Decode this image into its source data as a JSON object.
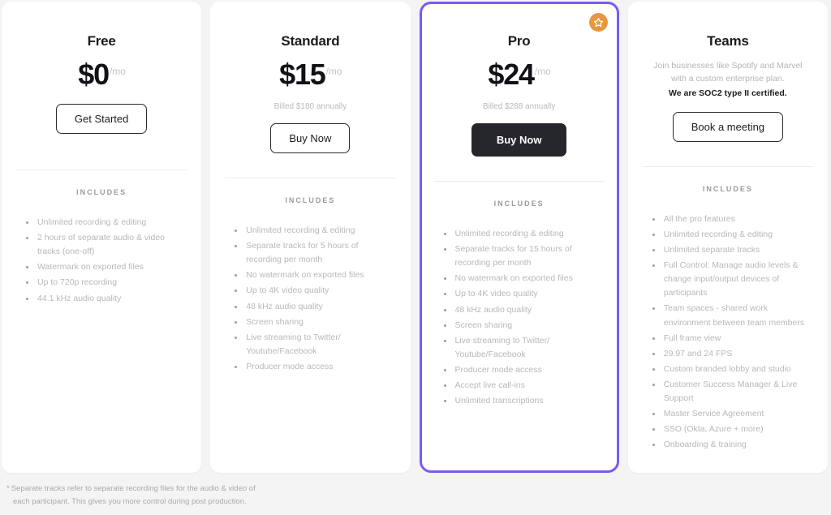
{
  "plans": [
    {
      "id": "free",
      "name": "Free",
      "price": "$0",
      "per": "/mo",
      "billed": "",
      "cta": "Get Started",
      "includes_label": "INCLUDES",
      "features": [
        "Unlimited recording & editing",
        "2 hours of separate audio & video tracks (one-off)",
        "Watermark on exported files",
        "Up to 720p recording",
        "44.1 kHz audio quality"
      ]
    },
    {
      "id": "standard",
      "name": "Standard",
      "price": "$15",
      "per": "/mo",
      "billed": "Billed $180 annually",
      "cta": "Buy Now",
      "includes_label": "INCLUDES",
      "features": [
        "Unlimited recording & editing",
        "Separate tracks for 5 hours of recording per month",
        "No watermark on exported files",
        "Up to 4K video quality",
        "48 kHz audio quality",
        "Screen sharing",
        "Live streaming to Twitter/ Youtube/Facebook",
        "Producer mode access"
      ]
    },
    {
      "id": "pro",
      "name": "Pro",
      "price": "$24",
      "per": "/mo",
      "billed": "Billed $288 annually",
      "cta": "Buy Now",
      "includes_label": "INCLUDES",
      "badge_icon": "star-badge-icon",
      "features": [
        "Unlimited recording & editing",
        "Separate tracks for 15 hours of recording per month",
        "No watermark on exported files",
        "Up to 4K video quality",
        "48 kHz audio quality",
        "Screen sharing",
        "Live streaming to Twitter/ Youtube/Facebook",
        "Producer mode access",
        "Accept live call-ins",
        "Unlimited transcriptions"
      ]
    },
    {
      "id": "teams",
      "name": "Teams",
      "description": "Join businesses like Spotify and Marvel with a custom enterprise plan.",
      "description_strong": "We are SOC2 type II certified.",
      "cta": "Book a meeting",
      "includes_label": "INCLUDES",
      "features": [
        "All the pro features",
        "Unlimited recording & editing",
        "Unlimited separate tracks",
        "Full Control: Manage audio levels & change input/output devices of participants",
        "Team spaces - shared work environment between team members",
        "Full frame view",
        "29.97 and 24 FPS",
        "Custom branded lobby and studio",
        "Customer Success Manager & Live Support",
        "Master Service Agreement",
        "SSO (Okta, Azure + more)",
        "Onboarding & training"
      ]
    }
  ],
  "footnote": {
    "marker": "*",
    "line1": "Separate tracks refer to separate recording files for the audio & video of",
    "line2": "each participant. This gives you more control during post production."
  },
  "colors": {
    "featured_border": "#7a5af5",
    "badge": "#e8973f",
    "dark_button": "#26272d",
    "page_background": "#f4f4f5"
  }
}
